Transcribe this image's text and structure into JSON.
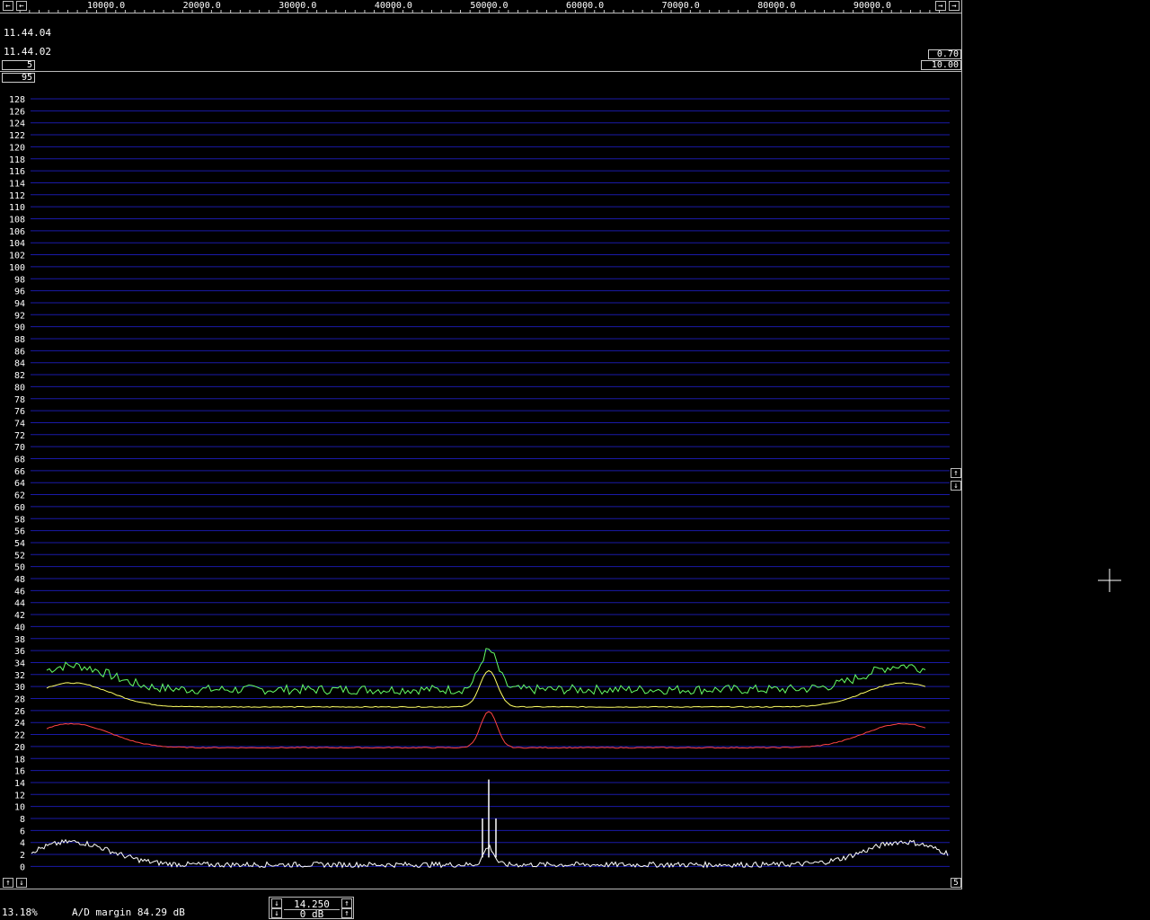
{
  "freq_axis": {
    "labels": [
      "10000.0",
      "20000.0",
      "30000.0",
      "40000.0",
      "50000.0",
      "60000.0",
      "70000.0",
      "80000.0",
      "90000.0"
    ],
    "left_arrow": "←",
    "right_arrow": "→"
  },
  "waterfall_times": [
    "11.44.04",
    "11.44.02"
  ],
  "params": {
    "left_value_1": "5",
    "left_value_2": "95",
    "right_value_1": "0.70",
    "right_value_2": "10.00"
  },
  "spectrum": {
    "y_labels": [
      "128",
      "126",
      "124",
      "122",
      "120",
      "118",
      "116",
      "114",
      "112",
      "110",
      "108",
      "106",
      "104",
      "102",
      "100",
      "98",
      "96",
      "94",
      "92",
      "90",
      "88",
      "86",
      "84",
      "82",
      "80",
      "78",
      "76",
      "74",
      "72",
      "70",
      "68",
      "66",
      "64",
      "62",
      "60",
      "58",
      "56",
      "54",
      "52",
      "50",
      "48",
      "46",
      "44",
      "42",
      "40",
      "38",
      "36",
      "34",
      "32",
      "30",
      "28",
      "26",
      "24",
      "22",
      "20",
      "18",
      "16",
      "14",
      "12",
      "10",
      "8",
      "6",
      "4",
      "2",
      "0"
    ],
    "scroll_up": "↑",
    "scroll_down": "↓",
    "bottom_right_value": "5",
    "colors": {
      "grid": "#1a1aa8",
      "green": "#66ff66",
      "yellow": "#ffff66",
      "red": "#ff4444",
      "white": "#ffffff"
    }
  },
  "status": {
    "percent": "13.18%",
    "ad_margin": "A/D margin 84.29 dB",
    "gain_value": "14.250",
    "db_value": "0 dB",
    "up_arrow": "↑",
    "down_arrow": "↓"
  }
}
